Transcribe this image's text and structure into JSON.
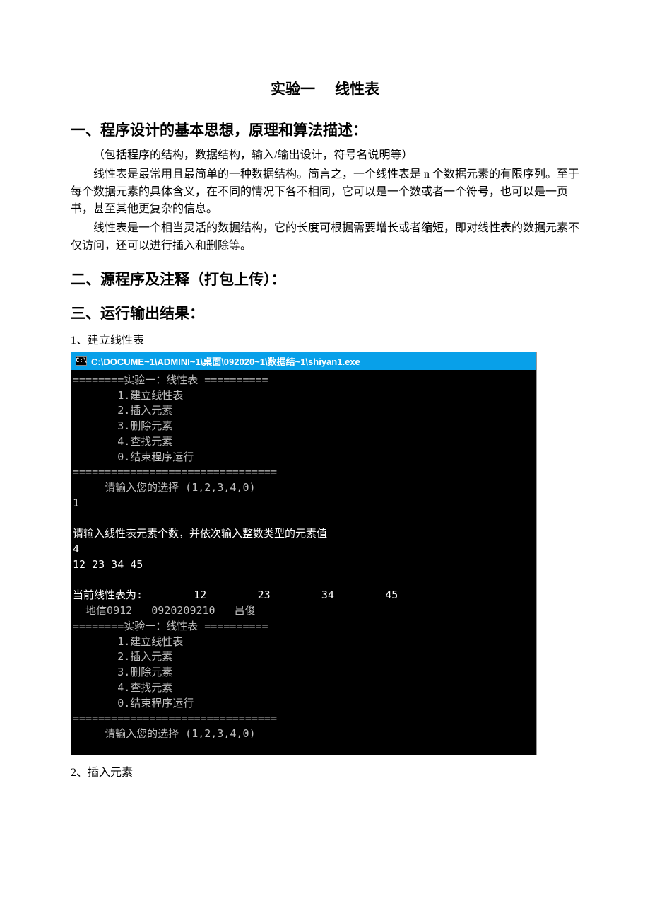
{
  "doc": {
    "title_a": "实验一",
    "title_b": "线性表",
    "h_section1": "一、程序设计的基本思想，原理和算法描述：",
    "p1": "（包括程序的结构，数据结构，输入/输出设计，符号名说明等）",
    "p2": "线性表是最常用且最简单的一种数据结构。简言之，一个线性表是 n 个数据元素的有限序列。至于每个数据元素的具体含义，在不同的情况下各不相同，它可以是一个数或者一个符号，也可以是一页书，甚至其他更复杂的信息。",
    "p3": "线性表是一个相当灵活的数据结构，它的长度可根据需要增长或者缩短，即对线性表的数据元素不仅访问，还可以进行插入和删除等。",
    "h_section2": "二、源程序及注释（打包上传）：",
    "h_section3": "三、运行输出结果：",
    "sub1": "1、建立线性表",
    "sub2": "2、插入元素"
  },
  "console": {
    "icon_text": "C:\\",
    "title": "C:\\DOCUME~1\\ADMINI~1\\桌面\\092020~1\\数据结~1\\shiyan1.exe",
    "lines": [
      "========实验一：线性表 ==========",
      "       1.建立线性表",
      "       2.插入元素",
      "       3.删除元素",
      "       4.查找元素",
      "       0.结束程序运行",
      "================================",
      "     请输入您的选择 (1,2,3,4,0)",
      "1",
      "",
      "请输入线性表元素个数，并依次输入整数类型的元素值",
      "4",
      "12 23 34 45",
      "",
      "当前线性表为:        12        23        34        45",
      "  地信0912   0920209210   吕俊",
      "========实验一：线性表 ==========",
      "       1.建立线性表",
      "       2.插入元素",
      "       3.删除元素",
      "       4.查找元素",
      "       0.结束程序运行",
      "================================",
      "     请输入您的选择 (1,2,3,4,0)"
    ]
  }
}
